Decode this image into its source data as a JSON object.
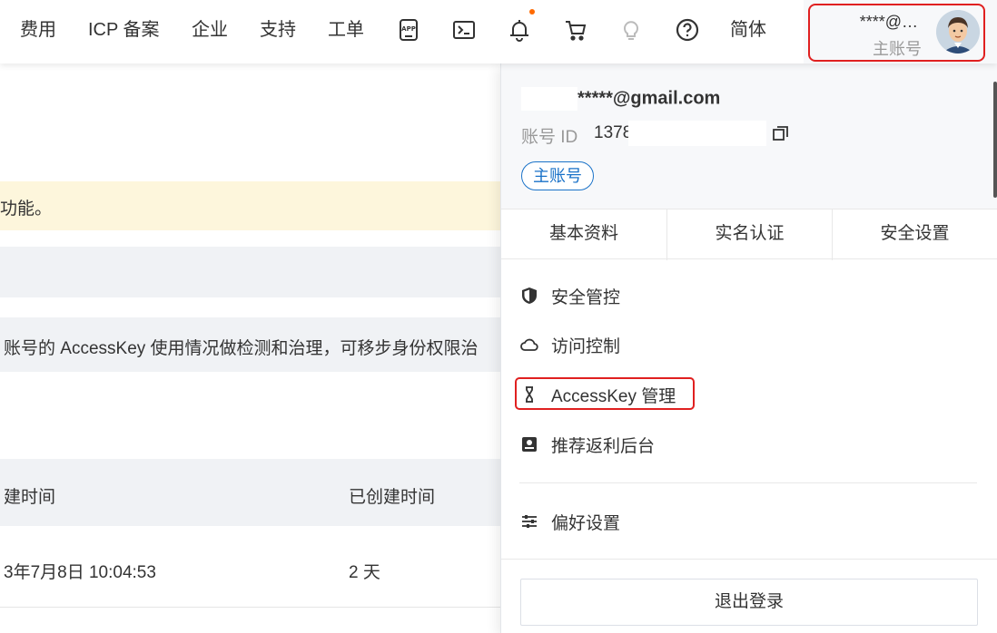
{
  "nav": {
    "fees": "费用",
    "icp": "ICP 备案",
    "enterprise": "企业",
    "support": "支持",
    "ticket": "工单",
    "lang": "简体",
    "icons": [
      "app-icon",
      "terminal-icon",
      "bell-icon",
      "cart-icon",
      "lightbulb-icon",
      "help-icon"
    ]
  },
  "account": {
    "email_short": "****@…",
    "type": "主账号"
  },
  "background": {
    "banner_text": "功能。",
    "info_text": "账号的 AccessKey 使用情况做检测和治理，可移步身份权限治",
    "table_headers": [
      "建时间",
      "已创建时间"
    ],
    "table_row": [
      "3年7月8日 10:04:53",
      "2 天"
    ]
  },
  "panel": {
    "email": "*****@gmail.com",
    "id_label": "账号 ID",
    "id_value": "1378",
    "badge": "主账号",
    "tabs": [
      "基本资料",
      "实名认证",
      "安全设置"
    ],
    "menu": [
      {
        "label": "安全管控",
        "icon": "shield-icon"
      },
      {
        "label": "访问控制",
        "icon": "cloud-icon"
      },
      {
        "label": "AccessKey 管理",
        "icon": "key-icon"
      },
      {
        "label": "推荐返利后台",
        "icon": "dashboard-icon"
      },
      {
        "label": "偏好设置",
        "icon": "sliders-icon"
      }
    ],
    "logout": "退出登录"
  },
  "colors": {
    "highlight": "#e02020",
    "badge": "#1a72c8",
    "notify": "#ff6a00",
    "banner": "#fdf6dc"
  }
}
